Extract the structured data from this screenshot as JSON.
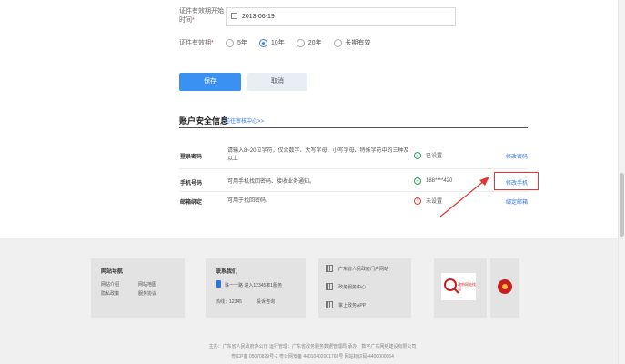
{
  "form": {
    "start_date_label_1": "证件有效期开始",
    "start_date_label_2": "时间",
    "required_mark": "*",
    "start_date_value": "2013-06-19",
    "validity_label": "证件有效期",
    "validity_options": [
      "5年",
      "10年",
      "20年",
      "长期有效"
    ],
    "validity_selected": "10年",
    "save_label": "保存",
    "cancel_label": "取消"
  },
  "security": {
    "title": "账户安全信息",
    "link": "前往审核中心>>",
    "rows": [
      {
        "label": "登录密码",
        "desc": "请输入8~20位字符，仅含数字、大写字母、小写字母、特殊字符中的三种及以上",
        "status": "已设置",
        "status_type": "ok",
        "action": "修改密码"
      },
      {
        "label": "手机号码",
        "desc": "可用手机找回密码、接收业务通知。",
        "status": "188****420",
        "status_type": "ok",
        "action": "修改手机"
      },
      {
        "label": "邮箱绑定",
        "desc": "可用于找回密码。",
        "status": "未设置",
        "status_type": "warn",
        "action": "绑定邮箱"
      }
    ],
    "highlight_color": "#e33333"
  },
  "footer": {
    "site_nav": {
      "title": "网站导航",
      "links": [
        "网站介绍",
        "网站地图",
        "隐私政策",
        "服务协议"
      ]
    },
    "contact": {
      "title": "联系我们",
      "address": "珠一一路 进入12345率1服务",
      "hotline_label": "热线：12345",
      "feedback": "投诉咨询"
    },
    "apps": [
      "广东省人民政府门户网站",
      "政务服务中心",
      "掌上政务APP"
    ],
    "badge1_text": "政府网站找错",
    "legal_line1": "主办：广东省人民政府办公厅   运行管理：广东省政务服务数据管理局   承办：数字广东网络建设有限公司",
    "legal_line2": "粤ICP备 05070829号-2   粤公网安备 44010402001768号   网站标识码 4400000064"
  },
  "colors": {
    "primary": "#3b91f1",
    "link": "#2f78d8",
    "ok": "#2aa55a",
    "warn": "#e33333"
  }
}
